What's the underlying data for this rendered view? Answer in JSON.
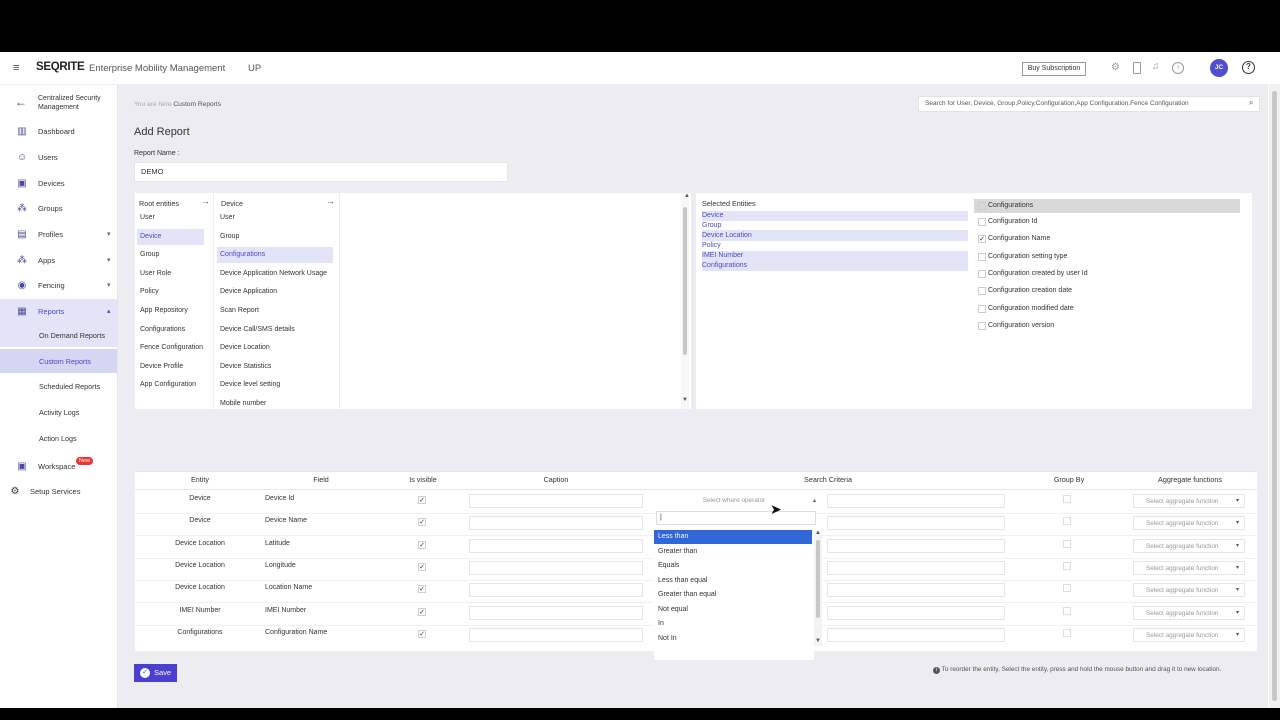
{
  "app": {
    "brand": "SEQRITE",
    "title": "Enterprise Mobility Management",
    "org_code": "UP",
    "buy_label": "Buy Subscription",
    "avatar": "JC"
  },
  "search": {
    "placeholder": "Search for User, Device, Group,Policy,Configuration,App Configuration,Fence Configuration"
  },
  "breadcrumb": {
    "prefix": "You are here",
    "current": "Custom Reports"
  },
  "sidebar": {
    "back_label": "Centralized Security Management",
    "items": [
      {
        "label": "Dashboard",
        "icon": "bar-chart-icon"
      },
      {
        "label": "Users",
        "icon": "user-icon"
      },
      {
        "label": "Devices",
        "icon": "device-icon"
      },
      {
        "label": "Groups",
        "icon": "groups-icon"
      },
      {
        "label": "Profiles",
        "icon": "profile-icon"
      },
      {
        "label": "Apps",
        "icon": "apps-icon"
      },
      {
        "label": "Fencing",
        "icon": "location-icon"
      },
      {
        "label": "Reports",
        "icon": "report-icon"
      }
    ],
    "report_sub": [
      "On Demand Reports",
      "Custom Reports",
      "Scheduled Reports",
      "Activity Logs",
      "Action Logs"
    ],
    "workspace": {
      "label": "Workspace",
      "badge": "New"
    },
    "setup": "Setup Services"
  },
  "page": {
    "title": "Add Report",
    "report_name_label": "Report Name :",
    "report_name_value": "DEMO"
  },
  "root_entities": {
    "header": "Root entities",
    "items": [
      "User",
      "Device",
      "Group",
      "User Role",
      "Policy",
      "App Repository",
      "Configurations",
      "Fence Configuration",
      "Device Profile",
      "App Configuration"
    ]
  },
  "device_entities": {
    "header": "Device",
    "items": [
      "User",
      "Group",
      "Configurations",
      "Device Application Network Usage",
      "Device Application",
      "Scan Report",
      "Device Call/SMS details",
      "Device Location",
      "Device Statistics",
      "Device level setting",
      "Mobile number"
    ]
  },
  "selected_entities": {
    "header": "Selected Entities",
    "items": [
      "Device",
      "Group",
      "Device Location",
      "Policy",
      "IMEI Number",
      "Configurations"
    ]
  },
  "configurations": {
    "header": "Configurations",
    "items": [
      "Configuration Id",
      "Configuration Name",
      "Configuration setting type",
      "Configuration created by user Id",
      "Configuration creation date",
      "Configuration modified date",
      "Configuration version"
    ],
    "checked": [
      false,
      true,
      false,
      false,
      false,
      false,
      false
    ]
  },
  "table": {
    "headers": [
      "Entity",
      "Field",
      "Is visible",
      "Caption",
      "Search Criteria",
      "Group By",
      "Aggregate functions"
    ],
    "rows": [
      {
        "entity": "Device",
        "field": "Device Id"
      },
      {
        "entity": "Device",
        "field": "Device Name"
      },
      {
        "entity": "Device Location",
        "field": "Latitude"
      },
      {
        "entity": "Device Location",
        "field": "Longitude"
      },
      {
        "entity": "Device Location",
        "field": "Location Name"
      },
      {
        "entity": "IMEI Number",
        "field": "IMEI Number"
      },
      {
        "entity": "Configurations",
        "field": "Configuration Name"
      }
    ],
    "operator_placeholder": "Select where operator",
    "aggregate_placeholder": "Select aggregate function",
    "check_mark": "✓"
  },
  "operator_dropdown": {
    "options": [
      "Less than",
      "Greater than",
      "Equals",
      "Less than equal",
      "Greater than equal",
      "Not equal",
      "In",
      "Not In"
    ]
  },
  "footer": {
    "save_label": "Save",
    "reorder_hint": "To reorder the entity, Select the entity, press and hold the mouse button and drag it to new location."
  }
}
